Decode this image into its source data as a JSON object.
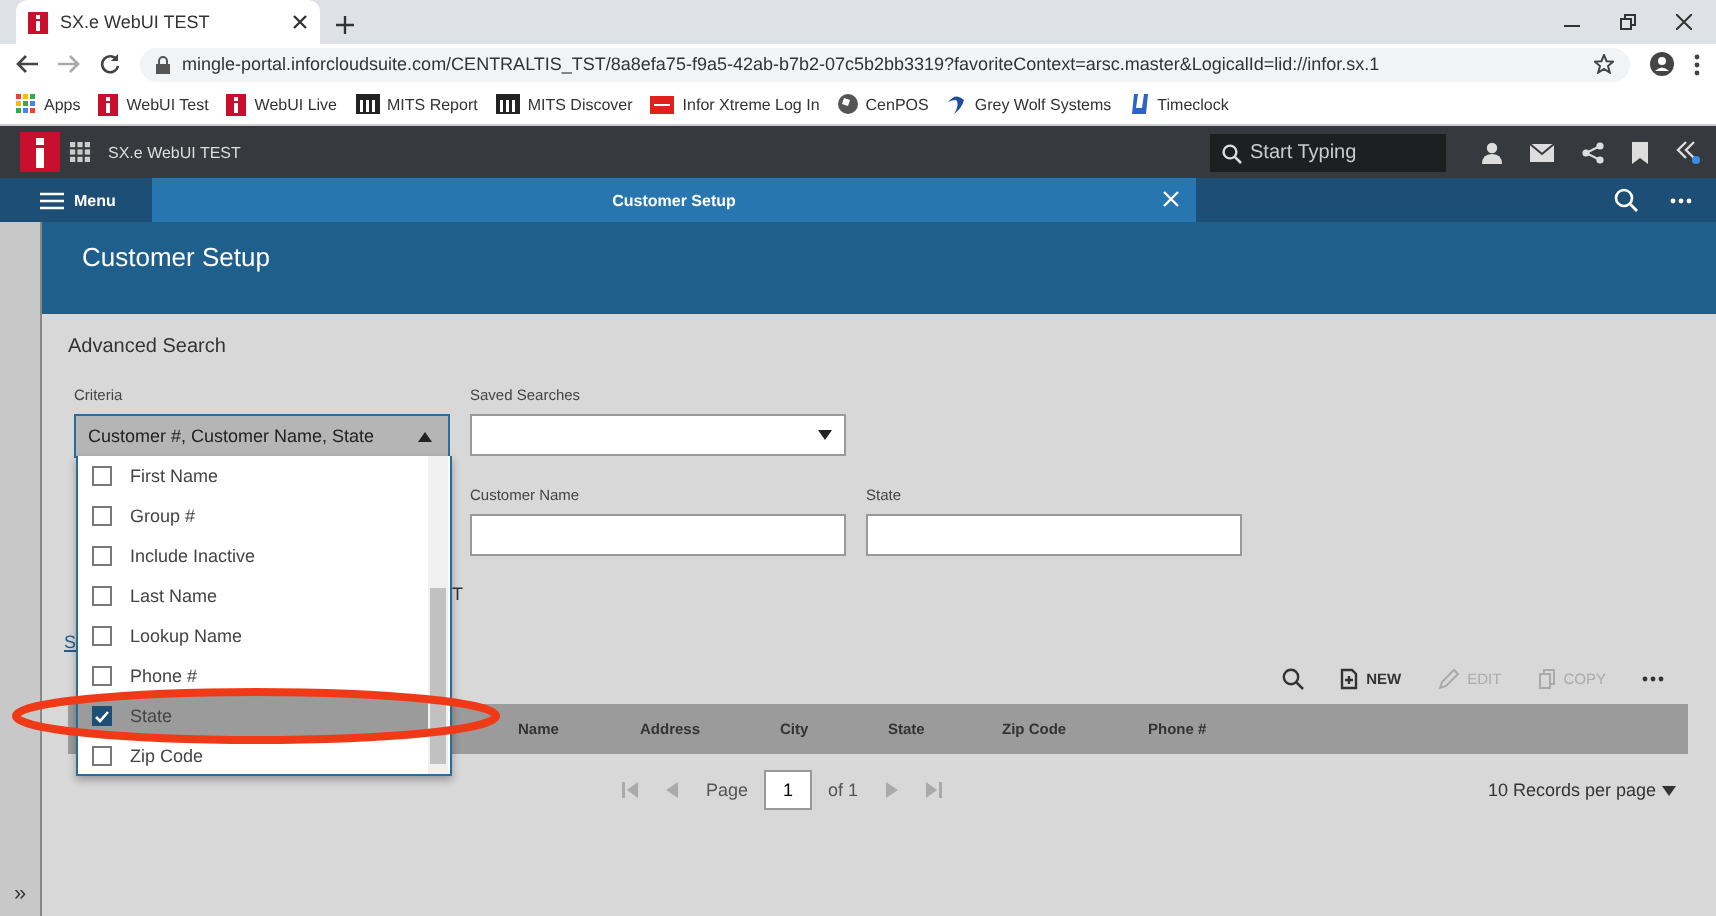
{
  "browser": {
    "tab_title": "SX.e WebUI TEST",
    "url": "mingle-portal.inforcloudsuite.com/CENTRALTIS_TST/8a8efa75-f9a5-42ab-b7b2-07c5b2bb3319?favoriteContext=arsc.master&LogicalId=lid://infor.sx.1",
    "bookmarks": [
      {
        "label": "Apps",
        "kind": "apps"
      },
      {
        "label": "WebUI Test",
        "kind": "infor"
      },
      {
        "label": "WebUI Live",
        "kind": "infor"
      },
      {
        "label": "MITS Report",
        "kind": "building"
      },
      {
        "label": "MITS Discover",
        "kind": "building"
      },
      {
        "label": "Infor Xtreme Log In",
        "kind": "red"
      },
      {
        "label": "CenPOS",
        "kind": "globe"
      },
      {
        "label": "Grey Wolf Systems",
        "kind": "swoosh"
      },
      {
        "label": "Timeclock",
        "kind": "cup"
      }
    ]
  },
  "app": {
    "title": "SX.e WebUI TEST",
    "search": {
      "placeholder": "Start Typing"
    }
  },
  "nav": {
    "menu": "Menu",
    "tab": "Customer Setup"
  },
  "sidebar": {
    "toggle": "»"
  },
  "page": {
    "title": "Customer Setup",
    "section": "Advanced Search",
    "criteria": {
      "label": "Criteria",
      "value": "Customer #, Customer Name, State",
      "expanded": true,
      "options": [
        {
          "label": "First Name",
          "checked": false,
          "selected": false
        },
        {
          "label": "Group #",
          "checked": false,
          "selected": false
        },
        {
          "label": "Include Inactive",
          "checked": false,
          "selected": false
        },
        {
          "label": "Last Name",
          "checked": false,
          "selected": false
        },
        {
          "label": "Lookup Name",
          "checked": false,
          "selected": false
        },
        {
          "label": "Phone #",
          "checked": false,
          "selected": false
        },
        {
          "label": "State",
          "checked": true,
          "selected": true
        },
        {
          "label": "Zip Code",
          "checked": false,
          "selected": false
        }
      ]
    },
    "saved_searches": {
      "label": "Saved Searches"
    },
    "fields": [
      {
        "label": "Customer Name"
      },
      {
        "label": "State"
      }
    ],
    "fragments": [
      "T",
      "S"
    ],
    "toolbar": [
      {
        "kind": "new",
        "label": "NEW",
        "disabled": false
      },
      {
        "kind": "edit",
        "label": "EDIT",
        "disabled": true
      },
      {
        "kind": "copy",
        "label": "COPY",
        "disabled": true
      }
    ],
    "grid": {
      "columns": [
        "Name",
        "Address",
        "City",
        "State",
        "Zip Code",
        "Phone #"
      ]
    },
    "pager": {
      "label": "Page",
      "page": "1",
      "of": "of 1",
      "per_page": "10 Records per page"
    }
  }
}
